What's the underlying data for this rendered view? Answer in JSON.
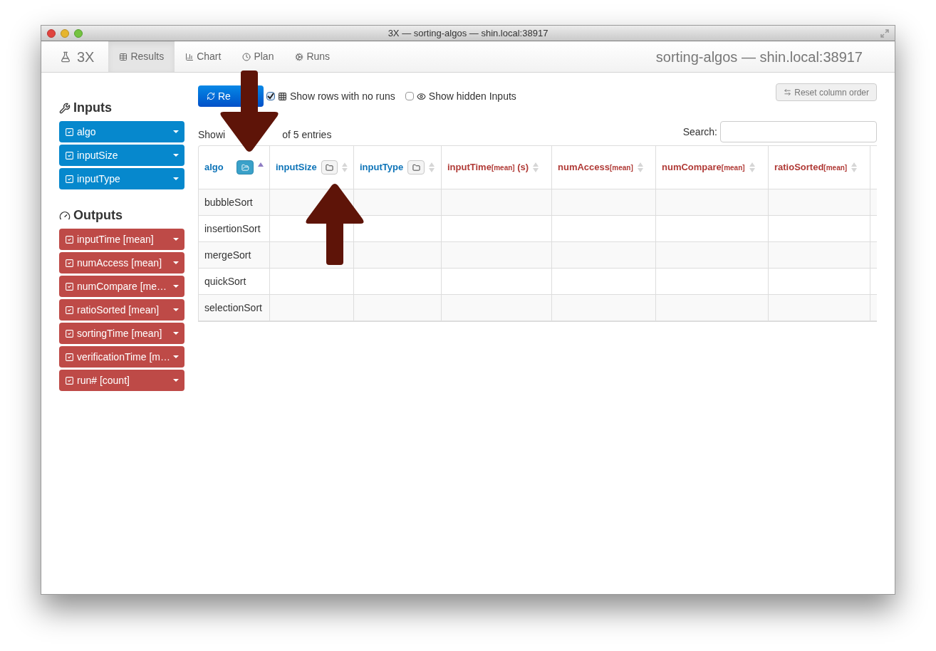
{
  "window": {
    "title": "3X — sorting-algos — shin.local:38917"
  },
  "brand": "3X",
  "tabs": [
    {
      "label": "Results",
      "selected": true
    },
    {
      "label": "Chart",
      "selected": false
    },
    {
      "label": "Plan",
      "selected": false
    },
    {
      "label": "Runs",
      "selected": false
    }
  ],
  "header_right": "sorting-algos — shin.local:38917",
  "sidebar": {
    "inputs_title": "Inputs",
    "inputs": [
      {
        "label": "algo",
        "checked": true
      },
      {
        "label": "inputSize",
        "checked": true
      },
      {
        "label": "inputType",
        "checked": true
      }
    ],
    "outputs_title": "Outputs",
    "outputs": [
      {
        "label": "inputTime [mean]",
        "checked": true
      },
      {
        "label": "numAccess [mean]",
        "checked": true
      },
      {
        "label": "numCompare [me…",
        "checked": true
      },
      {
        "label": "ratioSorted [mean]",
        "checked": true
      },
      {
        "label": "sortingTime [mean]",
        "checked": true
      },
      {
        "label": "verificationTime [m…",
        "checked": true
      },
      {
        "label": "run# [count]",
        "checked": true
      }
    ]
  },
  "toolbar": {
    "reload_button": "Re",
    "options": [
      {
        "label": "Show rows with no runs",
        "checked": true
      },
      {
        "label": "Show hidden Inputs",
        "checked": false
      }
    ],
    "reset_button": "Reset column order"
  },
  "table_info": {
    "start": "Showi",
    "end": "of 5 entries"
  },
  "search": {
    "label": "Search:"
  },
  "table": {
    "columns": [
      {
        "kind": "input",
        "name": "algo",
        "grouped": true,
        "sorted": true
      },
      {
        "kind": "input",
        "name": "inputSize",
        "grouped": false,
        "sorted": false
      },
      {
        "kind": "input",
        "name": "inputType",
        "grouped": false,
        "sorted": false
      },
      {
        "kind": "output",
        "name": "inputTime",
        "agg": "[mean]",
        "unit": "(s)",
        "sorted": false
      },
      {
        "kind": "output",
        "name": "numAccess",
        "agg": "[mean]",
        "sorted": false
      },
      {
        "kind": "output",
        "name": "numCompare",
        "agg": "[mean]",
        "sorted": false
      },
      {
        "kind": "output",
        "name": "ratioSorted",
        "agg": "[mean]",
        "sorted": false
      }
    ],
    "rows": [
      [
        "bubbleSort"
      ],
      [
        "insertionSort"
      ],
      [
        "mergeSort"
      ],
      [
        "quickSort"
      ],
      [
        "selectionSort"
      ]
    ]
  },
  "annotations": [
    {
      "kind": "down-arrow"
    },
    {
      "kind": "up-arrow"
    }
  ]
}
